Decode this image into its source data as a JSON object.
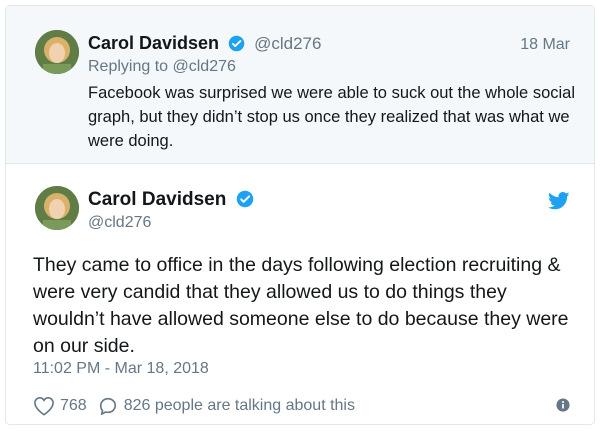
{
  "parent_tweet": {
    "author_name": "Carol Davidsen",
    "author_handle": "@cld276",
    "date": "18 Mar",
    "replying_to": "Replying to @cld276",
    "text": "Facebook was surprised we were able to suck out the whole social graph, but they didn’t stop us once they realized that was what we were doing."
  },
  "main_tweet": {
    "author_name": "Carol Davidsen",
    "author_handle": "@cld276",
    "text": "They came to office in the days following election recruiting & were very candid that they allowed us to do things they wouldn’t have allowed someone else to do because they were on our side.",
    "timestamp": "11:02 PM - Mar 18, 2018",
    "likes": "768",
    "talking": "826 people are talking about this"
  },
  "icons": {
    "verified": "verified-badge-icon",
    "bird": "twitter-bird-icon",
    "heart": "heart-icon",
    "comment": "comment-icon",
    "info": "info-icon"
  },
  "colors": {
    "accent": "#1da1f2",
    "muted": "#657786",
    "text": "#14171a",
    "parent_bg": "#f5f8fa"
  }
}
